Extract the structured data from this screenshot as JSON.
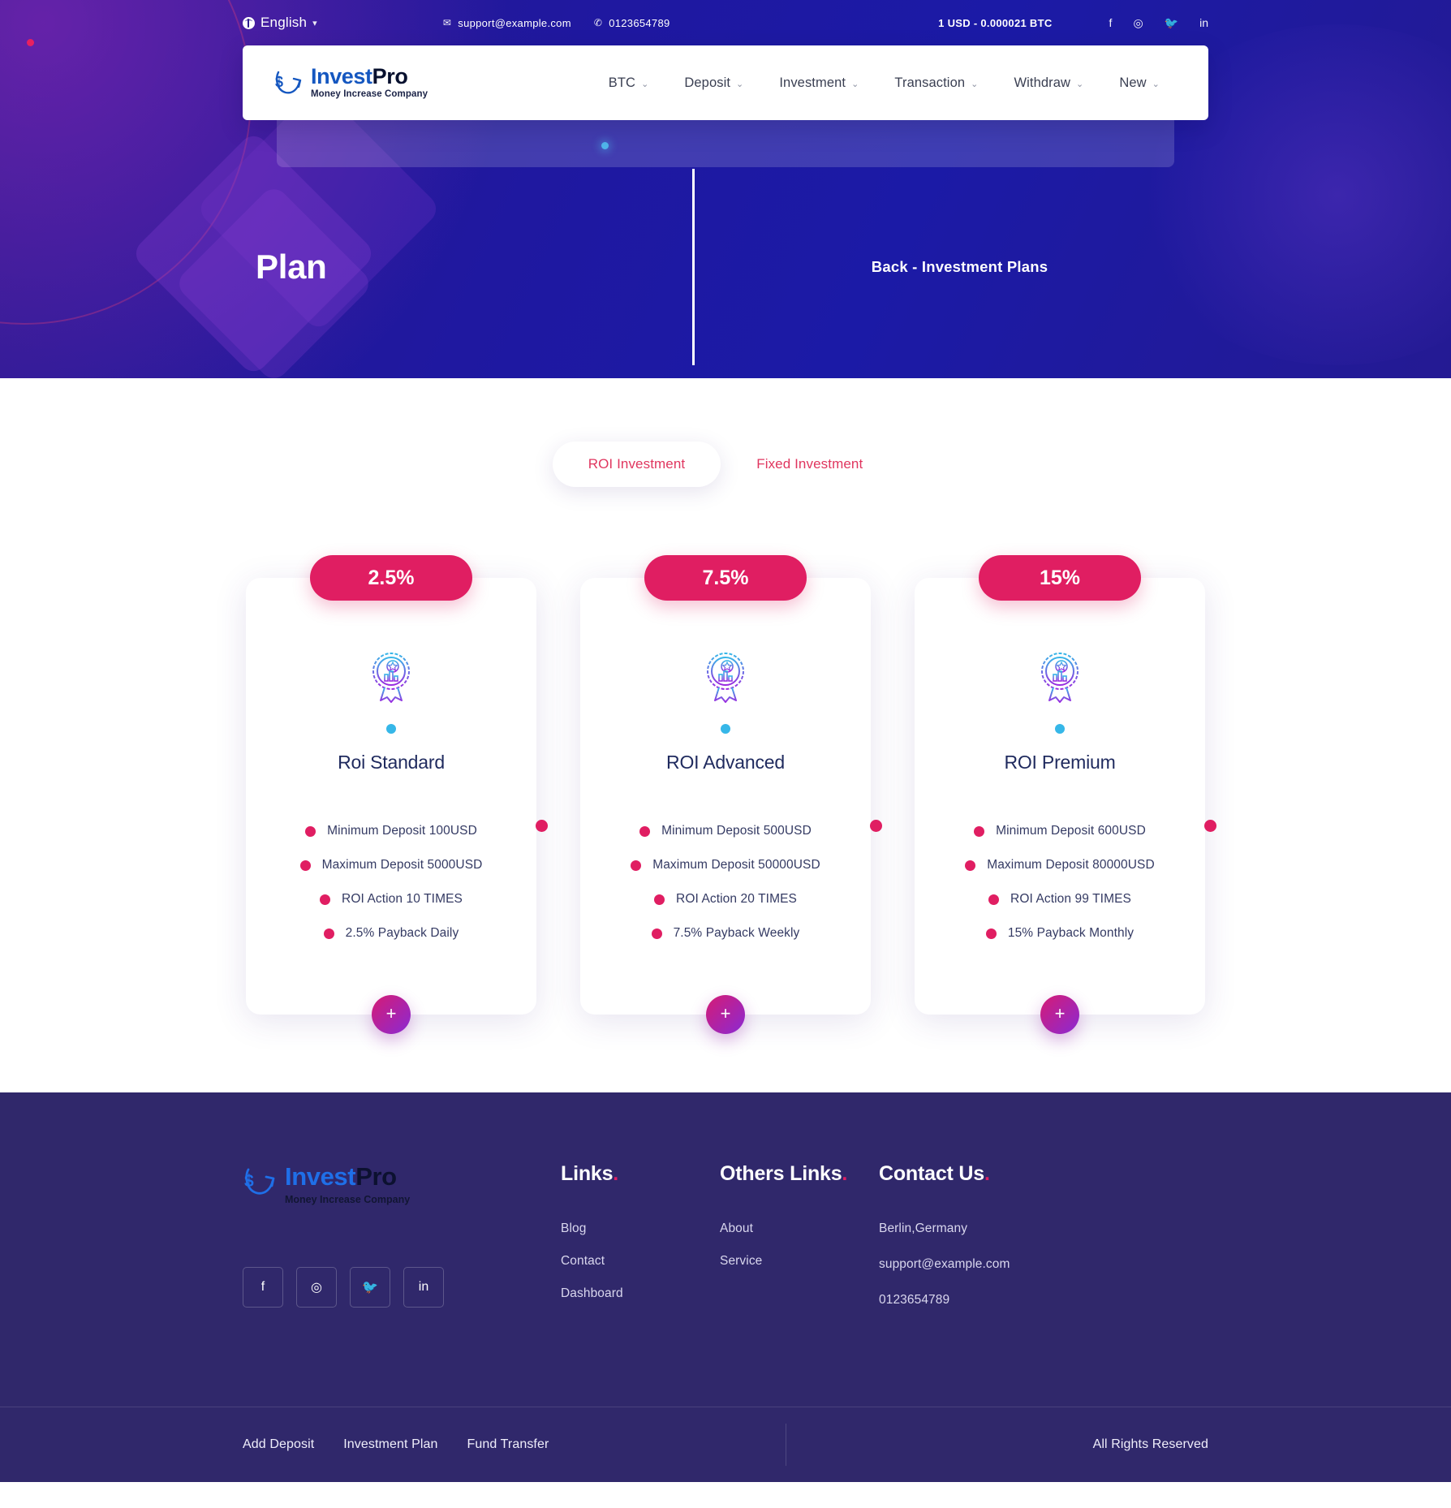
{
  "topbar": {
    "language": "English",
    "email": "support@example.com",
    "phone": "0123654789",
    "rate": "1 USD - 0.000021 BTC",
    "socials": [
      "facebook-icon",
      "instagram-icon",
      "twitter-icon",
      "linkedin-icon"
    ]
  },
  "brand": {
    "name_first": "Invest",
    "name_second": "Pro",
    "tagline": "Money Increase Company"
  },
  "nav": {
    "items": [
      {
        "label": "BTC"
      },
      {
        "label": "Deposit"
      },
      {
        "label": "Investment"
      },
      {
        "label": "Transaction"
      },
      {
        "label": "Withdraw"
      },
      {
        "label": "New"
      }
    ]
  },
  "hero": {
    "title": "Plan",
    "breadcrumb": "Back  -  Investment Plans"
  },
  "plans": {
    "tabs": [
      {
        "label": "ROI Investment",
        "active": true
      },
      {
        "label": "Fixed Investment",
        "active": false
      }
    ],
    "cards": [
      {
        "badge": "2.5%",
        "title": "Roi Standard",
        "features": [
          "Minimum Deposit 100USD",
          "Maximum Deposit 5000USD",
          "ROI Action 10 TIMES",
          "2.5% Payback Daily"
        ],
        "action": "+"
      },
      {
        "badge": "7.5%",
        "title": "ROI Advanced",
        "features": [
          "Minimum Deposit 500USD",
          "Maximum Deposit 50000USD",
          "ROI Action 20 TIMES",
          "7.5% Payback Weekly"
        ],
        "action": "+"
      },
      {
        "badge": "15%",
        "title": "ROI Premium",
        "features": [
          "Minimum Deposit 600USD",
          "Maximum Deposit 80000USD",
          "ROI Action 99 TIMES",
          "15% Payback Monthly"
        ],
        "action": "+"
      }
    ]
  },
  "footer": {
    "links_head": "Links",
    "links_dot": ".",
    "links": [
      "Blog",
      "Contact",
      "Dashboard"
    ],
    "others_head": "Others Links",
    "others_dot": ".",
    "others": [
      "About",
      "Service"
    ],
    "contact_head": "Contact Us",
    "contact_dot": ".",
    "contact": [
      "Berlin,Germany",
      "support@example.com",
      "0123654789"
    ],
    "socials": [
      "facebook-icon",
      "instagram-icon",
      "twitter-icon",
      "linkedin-icon"
    ],
    "bottom_links": [
      "Add Deposit",
      "Investment Plan",
      "Fund Transfer"
    ],
    "copyright": "All Rights Reserved"
  },
  "colors": {
    "accent_pink": "#e01e62",
    "hero_blue": "#1f18a0",
    "footer_purple": "#30286b",
    "logo_blue": "#1557c0",
    "dot_cyan": "#36b7e8"
  }
}
